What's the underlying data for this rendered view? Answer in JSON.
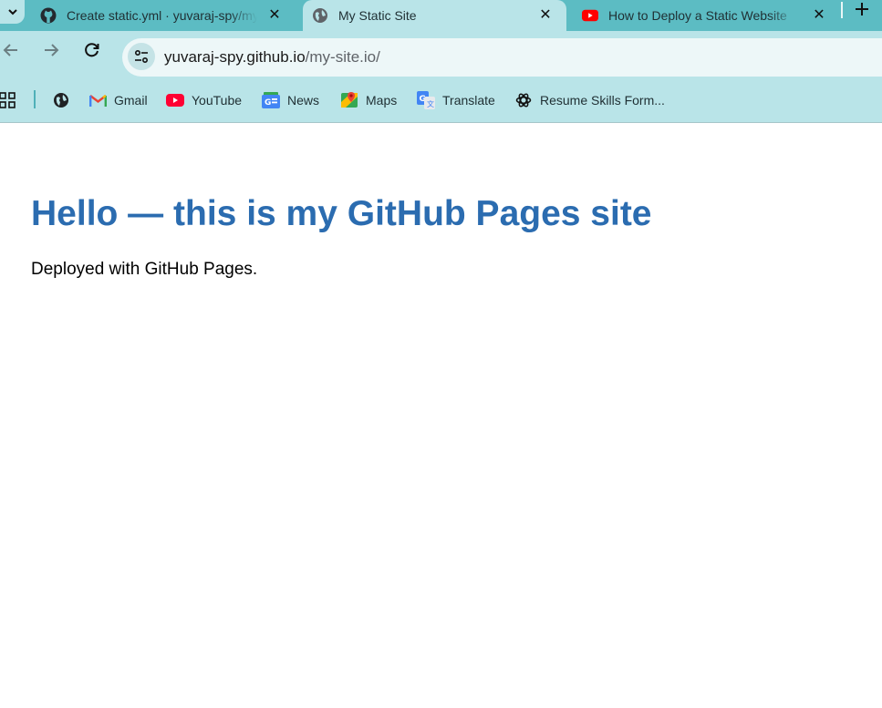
{
  "tabs": [
    {
      "title": "Create static.yml · yuvaraj-spy/my-site.io",
      "icon": "github-icon"
    },
    {
      "title": "My Static Site",
      "icon": "globe-icon",
      "active": true
    },
    {
      "title": "How to Deploy a Static Website",
      "icon": "youtube-icon"
    }
  ],
  "toolbar": {
    "url_host": "yuvaraj-spy.github.io",
    "url_path": "/my-site.io/"
  },
  "bookmarks": [
    {
      "label": "",
      "icon": "globe-icon"
    },
    {
      "label": "Gmail",
      "icon": "gmail-icon"
    },
    {
      "label": "YouTube",
      "icon": "youtube-icon"
    },
    {
      "label": "News",
      "icon": "news-icon"
    },
    {
      "label": "Maps",
      "icon": "maps-icon"
    },
    {
      "label": "Translate",
      "icon": "translate-icon"
    },
    {
      "label": "Resume Skills Form...",
      "icon": "chatgpt-icon"
    }
  ],
  "page": {
    "heading": "Hello — this is my GitHub Pages site",
    "text": "Deployed with GitHub Pages."
  },
  "colors": {
    "tabstrip": "#5cbcc3",
    "toolbar": "#b9e4e8",
    "heading": "#2b6cb0"
  }
}
